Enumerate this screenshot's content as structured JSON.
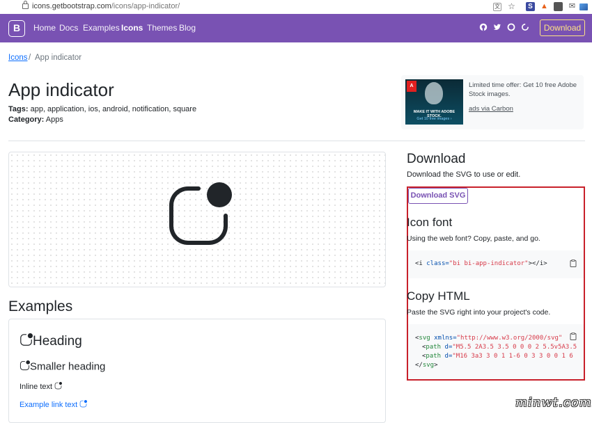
{
  "browser": {
    "url_host": "icons.getbootstrap.com",
    "url_path": "/icons/app-indicator/",
    "extensions": [
      "translate-icon",
      "star-icon",
      "s-extension-icon",
      "flame-extension-icon",
      "camera-extension-icon",
      "mail-icon",
      "screen-icon",
      "avatar-icon"
    ]
  },
  "nav": {
    "brand": "B",
    "links": [
      "Home",
      "Docs",
      "Examples",
      "Icons",
      "Themes",
      "Blog"
    ],
    "active": "Icons",
    "icons": [
      "github-icon",
      "twitter-icon",
      "opencollective-icon",
      "slack-icon"
    ],
    "download": "Download"
  },
  "breadcrumb": {
    "parent": "Icons",
    "separator": "/",
    "current": "App indicator"
  },
  "page": {
    "title": "App indicator",
    "tags_label": "Tags:",
    "tags": "app, application, ios, android, notification, square",
    "category_label": "Category:",
    "category": "Apps"
  },
  "ad": {
    "text": "Limited time offer: Get 10 free Adobe Stock images.",
    "via": "ads via Carbon",
    "image_caption": "MAKE IT WITH ADOBE STOCK.",
    "image_cta": "Get 10 free images ›"
  },
  "examples": {
    "heading": "Examples",
    "heading_text": "Heading",
    "smaller_heading": "Smaller heading",
    "inline_text": "Inline text",
    "link_text": "Example link text"
  },
  "download": {
    "heading": "Download",
    "desc": "Download the SVG to use or edit.",
    "button": "Download SVG"
  },
  "icon_font": {
    "heading": "Icon font",
    "desc": "Using the web font? Copy, paste, and go.",
    "code": [
      "<i ",
      "class=",
      "\"bi bi-app-indicator\"",
      "></",
      "i",
      ">"
    ]
  },
  "copy_html": {
    "heading": "Copy HTML",
    "desc": "Paste the SVG right into your project's code.",
    "line1": [
      "<",
      "svg",
      " xmlns=",
      "\"http://www.w3.org/2000/svg\""
    ],
    "line2": [
      "<",
      "path",
      " d=",
      "\"M5.5 2A3.5 3.5 0 0 0 2 5.5v5A3.5"
    ],
    "line3": [
      "<",
      "path",
      " d=",
      "\"M16 3a3 3 0 1 1-6 0 3 3 0 0 1 6"
    ],
    "line4": [
      "</",
      "svg",
      ">"
    ]
  },
  "watermark": "minwt.com",
  "colors": {
    "brand": "#7952b3",
    "accent": "#ffe484",
    "highlight_border": "#c8202a",
    "link": "#0d6efd"
  }
}
